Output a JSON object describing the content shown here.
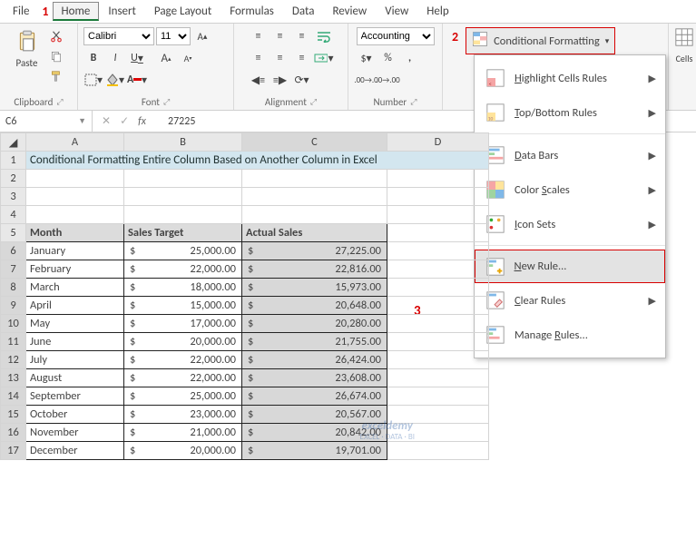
{
  "menu": {
    "file": "File",
    "home": "Home",
    "insert": "Insert",
    "pagelayout": "Page Layout",
    "formulas": "Formulas",
    "data": "Data",
    "review": "Review",
    "view": "View",
    "help": "Help"
  },
  "annot": {
    "one": "1",
    "two": "2",
    "three": "3"
  },
  "ribbon": {
    "clipboard": {
      "paste": "Paste",
      "label": "Clipboard"
    },
    "font": {
      "name": "Calibri",
      "size": "11",
      "bold": "B",
      "italic": "I",
      "underline": "U",
      "label": "Font"
    },
    "alignment": {
      "label": "Alignment"
    },
    "number": {
      "format": "Accounting",
      "label": "Number"
    },
    "cf_button": "Conditional Formatting",
    "cells": "Cells"
  },
  "dropdown": {
    "highlight": "Highlight Cells Rules",
    "topbottom": "Top/Bottom Rules",
    "databars": "Data Bars",
    "colorscales": "Color Scales",
    "iconsets": "Icon Sets",
    "newrule": "New Rule...",
    "clear": "Clear Rules",
    "manage": "Manage Rules...",
    "u": {
      "highlight": "H",
      "topbottom": "T",
      "databars": "D",
      "colorscales": "S",
      "iconsets": "I",
      "newrule": "N",
      "clear": "C",
      "manage": "R"
    }
  },
  "namebox": {
    "ref": "C6",
    "fx": "fx",
    "formula": "27225"
  },
  "headers": {
    "a": "A",
    "b": "B",
    "c": "C",
    "d": "D"
  },
  "title_row": "Conditional Formatting Entire Column Based on Another Column in Excel",
  "table_headers": {
    "month": "Month",
    "target": "Sales Target",
    "actual": "Actual Sales"
  },
  "currency": "$",
  "chart_data": {
    "type": "table",
    "columns": [
      "Month",
      "Sales Target",
      "Actual Sales"
    ],
    "rows": [
      {
        "month": "January",
        "target": "25,000.00",
        "actual": "27,225.00"
      },
      {
        "month": "February",
        "target": "22,000.00",
        "actual": "22,816.00"
      },
      {
        "month": "March",
        "target": "18,000.00",
        "actual": "15,973.00"
      },
      {
        "month": "April",
        "target": "15,000.00",
        "actual": "20,648.00"
      },
      {
        "month": "May",
        "target": "17,000.00",
        "actual": "20,280.00"
      },
      {
        "month": "June",
        "target": "20,000.00",
        "actual": "21,755.00"
      },
      {
        "month": "July",
        "target": "22,000.00",
        "actual": "26,424.00"
      },
      {
        "month": "August",
        "target": "22,000.00",
        "actual": "23,608.00"
      },
      {
        "month": "September",
        "target": "25,000.00",
        "actual": "26,674.00"
      },
      {
        "month": "October",
        "target": "23,000.00",
        "actual": "20,567.00"
      },
      {
        "month": "November",
        "target": "21,000.00",
        "actual": "20,842.00"
      },
      {
        "month": "December",
        "target": "20,000.00",
        "actual": "19,701.00"
      }
    ]
  },
  "watermark": {
    "brand": "exceldemy",
    "tag": "EXCEL · DATA · BI"
  }
}
